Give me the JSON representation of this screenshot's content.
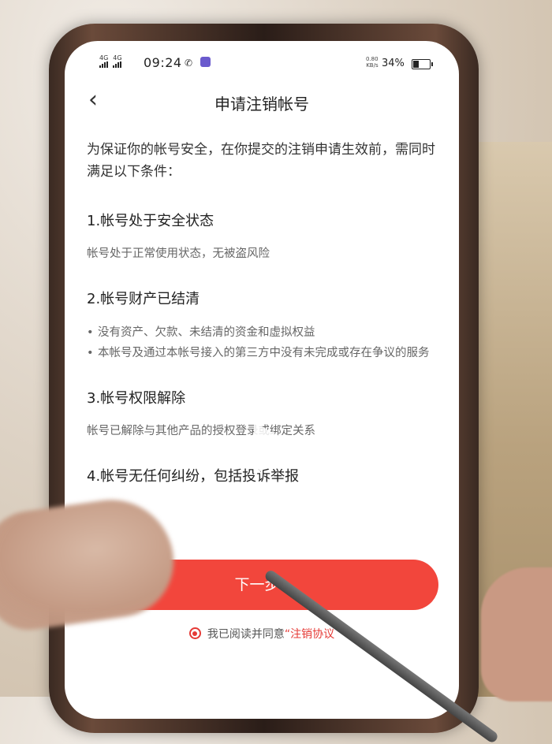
{
  "status_bar": {
    "network_1": "4G",
    "network_2": "4G",
    "time": "09:24",
    "net_speed_value": "0.80",
    "net_speed_unit": "KB/s",
    "battery": "34%"
  },
  "nav": {
    "back_label": "‹",
    "title": "申请注销帐号"
  },
  "intro": "为保证你的帐号安全，在你提交的注销申请生效前，需同时满足以下条件：",
  "conditions": [
    {
      "title": "1.帐号处于安全状态",
      "desc": "帐号处于正常使用状态，无被盗风险"
    },
    {
      "title": "2.帐号财产已结清",
      "bullets": [
        "没有资产、欠款、未结清的资金和虚拟权益",
        "本帐号及通过本帐号接入的第三方中没有未完成或存在争议的服务"
      ]
    },
    {
      "title": "3.帐号权限解除",
      "desc": "帐号已解除与其他产品的授权登录或绑定关系"
    },
    {
      "title": "4.帐号无任何纠纷，包括投诉举报"
    }
  ],
  "next_button": "下一步",
  "agreement": {
    "text": "我已阅读并同意",
    "link": "“注销协议"
  },
  "colors": {
    "accent": "#f2463c",
    "link": "#e53935"
  }
}
